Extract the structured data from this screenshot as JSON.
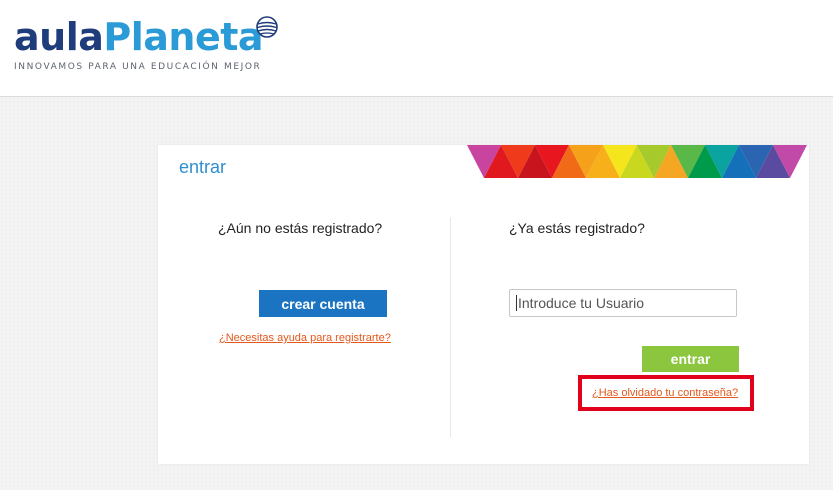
{
  "brand": {
    "part1": "aula",
    "part2": "Planeta",
    "tagline": "INNOVAMOS PARA UNA EDUCACIÓN MEJOR",
    "colors": {
      "dark_blue": "#1f3d7a",
      "light_blue": "#2b9bd7"
    }
  },
  "card": {
    "title": "entrar",
    "left": {
      "heading": "¿Aún no estás registrado?",
      "create_button": "crear cuenta",
      "help_link": "¿Necesitas ayuda para registrarte?"
    },
    "right": {
      "heading": "¿Ya estás registrado?",
      "username_placeholder": "Introduce tu Usuario",
      "enter_button": "entrar",
      "forgot_link": "¿Has olvidado tu contraseña?"
    }
  },
  "colors": {
    "create_button": "#1b74c2",
    "enter_button": "#8cc63f",
    "link": "#e4581c",
    "highlight": "#e3001b"
  }
}
